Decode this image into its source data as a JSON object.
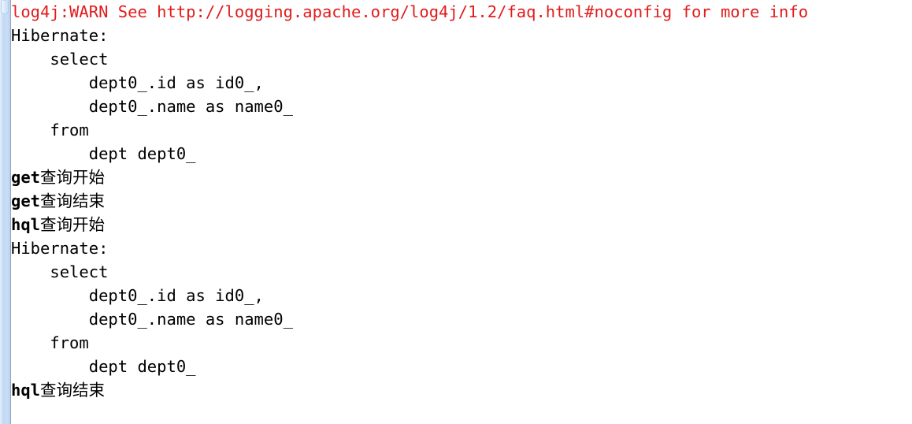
{
  "panel": {
    "name": "console-output",
    "background_color": "#ffffff",
    "gutter_color": "#c2d9f4",
    "gutter_separator_color": "#9aa4ae",
    "warn_color": "#e21b1b",
    "text_color": "#000000",
    "line_height_px": 30,
    "font_size_px": 20.5
  },
  "log": {
    "line_count": 15,
    "lines": [
      {
        "id": "line-1",
        "kind": "warn",
        "clipped": true,
        "text": "log4j:WARN See http://logging.apache.org/log4j/1.2/faq.html#noconfig for more info"
      },
      {
        "id": "line-2",
        "kind": "plain",
        "text": "Hibernate: "
      },
      {
        "id": "line-3",
        "kind": "plain",
        "text": "    select"
      },
      {
        "id": "line-4",
        "kind": "plain",
        "text": "        dept0_.id as id0_,"
      },
      {
        "id": "line-5",
        "kind": "plain",
        "text": "        dept0_.name as name0_"
      },
      {
        "id": "line-6",
        "kind": "plain",
        "text": "    from"
      },
      {
        "id": "line-7",
        "kind": "plain",
        "text": "        dept dept0_"
      },
      {
        "id": "line-8",
        "kind": "cjk",
        "head": "get",
        "tail": "查询开始"
      },
      {
        "id": "line-9",
        "kind": "cjk",
        "head": "get",
        "tail": "查询结束"
      },
      {
        "id": "line-10",
        "kind": "cjk",
        "head": "hql",
        "tail": "查询开始"
      },
      {
        "id": "line-11",
        "kind": "plain",
        "text": "Hibernate: "
      },
      {
        "id": "line-12",
        "kind": "plain",
        "text": "    select"
      },
      {
        "id": "line-13",
        "kind": "plain",
        "text": "        dept0_.id as id0_,"
      },
      {
        "id": "line-14",
        "kind": "plain",
        "text": "        dept0_.name as name0_"
      },
      {
        "id": "line-15",
        "kind": "plain",
        "text": "    from"
      },
      {
        "id": "line-16",
        "kind": "plain",
        "text": "        dept dept0_"
      },
      {
        "id": "line-17",
        "kind": "cjk",
        "head": "hql",
        "tail": "查询结束"
      }
    ]
  }
}
